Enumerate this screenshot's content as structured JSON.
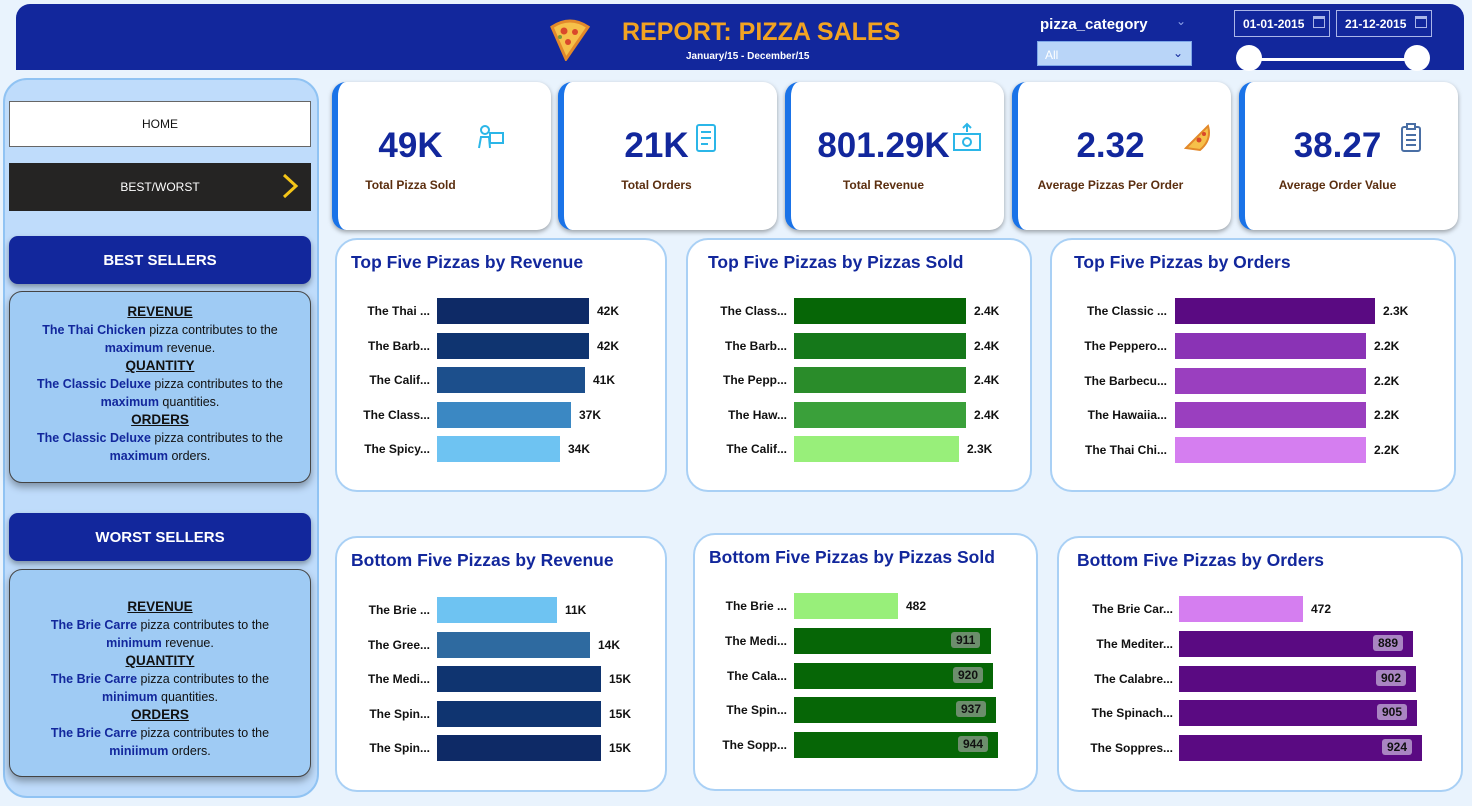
{
  "header": {
    "title": "REPORT: PIZZA SALES",
    "subtitle": "January/15 - December/15",
    "filter_label": "pizza_category",
    "filter_value": "All",
    "date_start": "01-01-2015",
    "date_end": "21-12-2015"
  },
  "nav": {
    "home": "HOME",
    "best_worst": "BEST/WORST"
  },
  "best": {
    "heading": "BEST SELLERS",
    "revenue_h": "REVENUE",
    "revenue_name": "The Thai Chicken",
    "revenue_t1": " pizza contributes to the ",
    "revenue_kw": "maximum",
    "revenue_t2": " revenue.",
    "qty_h": "QUANTITY",
    "qty_name": "The Classic Deluxe",
    "qty_t1": " pizza  contributes to the ",
    "qty_kw": "maximum",
    "qty_t2": " quantities.",
    "orders_h": "ORDERS",
    "orders_name": "The Classic Deluxe",
    "orders_t1": " pizza  contributes to the ",
    "orders_kw": "maximum",
    "orders_t2": " orders."
  },
  "worst": {
    "heading": "WORST SELLERS",
    "revenue_h": "REVENUE",
    "revenue_name": "The Brie Carre",
    "revenue_t1": " pizza contributes to the ",
    "revenue_kw": "minimum",
    "revenue_t2": " revenue.",
    "qty_h": "QUANTITY",
    "qty_name": "The Brie Carre",
    "qty_t1": " pizza  contributes to the ",
    "qty_kw": "minimum",
    "qty_t2": " quantities.",
    "orders_h": "ORDERS",
    "orders_name": "The Brie Carre",
    "orders_t1": " pizza  contributes to the ",
    "orders_kw": "miniimum",
    "orders_t2": " orders."
  },
  "kpis": [
    {
      "value": "49K",
      "label": "Total Pizza Sold",
      "icon": "delivery-icon"
    },
    {
      "value": "21K",
      "label": "Total Orders",
      "icon": "order-list-icon"
    },
    {
      "value": "801.29K",
      "label": "Total Revenue",
      "icon": "money-icon"
    },
    {
      "value": "2.32",
      "label": "Average Pizzas Per Order",
      "icon": "pizza-slice-icon"
    },
    {
      "value": "38.27",
      "label": "Average Order Value",
      "icon": "clipboard-icon"
    }
  ],
  "chart_data": [
    {
      "type": "bar",
      "title": "Top Five Pizzas by Revenue",
      "categories": [
        "The Thai ...",
        "The Barb...",
        "The Calif...",
        "The Class...",
        "The Spicy..."
      ],
      "values": [
        42,
        42,
        41,
        37,
        34
      ],
      "labels": [
        "42K",
        "42K",
        "41K",
        "37K",
        "34K"
      ],
      "colors": [
        "#0e2a66",
        "#0f3470",
        "#1c4f8c",
        "#3b88c3",
        "#6ec3f2"
      ]
    },
    {
      "type": "bar",
      "title": "Top Five Pizzas by Pizzas Sold",
      "categories": [
        "The Class...",
        "The Barb...",
        "The Pepp...",
        "The Haw...",
        "The Calif..."
      ],
      "values": [
        2.4,
        2.4,
        2.4,
        2.4,
        2.3
      ],
      "labels": [
        "2.4K",
        "2.4K",
        "2.4K",
        "2.4K",
        "2.3K"
      ],
      "colors": [
        "#066606",
        "#15781a",
        "#2a8c2a",
        "#3aa03a",
        "#98ef7a"
      ]
    },
    {
      "type": "bar",
      "title": "Top Five Pizzas by Orders",
      "categories": [
        "The Classic ...",
        "The Peppero...",
        "The Barbecu...",
        "The Hawaiia...",
        "The Thai Chi..."
      ],
      "values": [
        2.3,
        2.2,
        2.2,
        2.2,
        2.2
      ],
      "labels": [
        "2.3K",
        "2.2K",
        "2.2K",
        "2.2K",
        "2.2K"
      ],
      "colors": [
        "#5a0a82",
        "#8a33b5",
        "#9a3fbf",
        "#9a3fbf",
        "#d57ef0"
      ]
    },
    {
      "type": "bar",
      "title": "Bottom Five Pizzas by Revenue",
      "categories": [
        "The Brie ...",
        "The Gree...",
        "The Medi...",
        "The Spin...",
        "The Spin..."
      ],
      "values": [
        11,
        14,
        15,
        15,
        15
      ],
      "labels": [
        "11K",
        "14K",
        "15K",
        "15K",
        "15K"
      ],
      "colors": [
        "#6ec3f2",
        "#2e6aa0",
        "#0f3470",
        "#0f3470",
        "#0e2a66"
      ]
    },
    {
      "type": "bar",
      "title": "Bottom Five Pizzas by Pizzas Sold",
      "categories": [
        "The Brie ...",
        "The Medi...",
        "The Cala...",
        "The Spin...",
        "The Sopp..."
      ],
      "values": [
        482,
        911,
        920,
        937,
        944
      ],
      "labels": [
        "482",
        "911",
        "920",
        "937",
        "944"
      ],
      "colors": [
        "#98ef7a",
        "#066606",
        "#066606",
        "#066606",
        "#066606"
      ]
    },
    {
      "type": "bar",
      "title": "Bottom Five Pizzas by Orders",
      "categories": [
        "The Brie Car...",
        "The Mediter...",
        "The Calabre...",
        "The Spinach...",
        "The Soppres..."
      ],
      "values": [
        472,
        889,
        902,
        905,
        924
      ],
      "labels": [
        "472",
        "889",
        "902",
        "905",
        "924"
      ],
      "colors": [
        "#d57ef0",
        "#5a0a82",
        "#5a0a82",
        "#5a0a82",
        "#5a0a82"
      ]
    }
  ]
}
